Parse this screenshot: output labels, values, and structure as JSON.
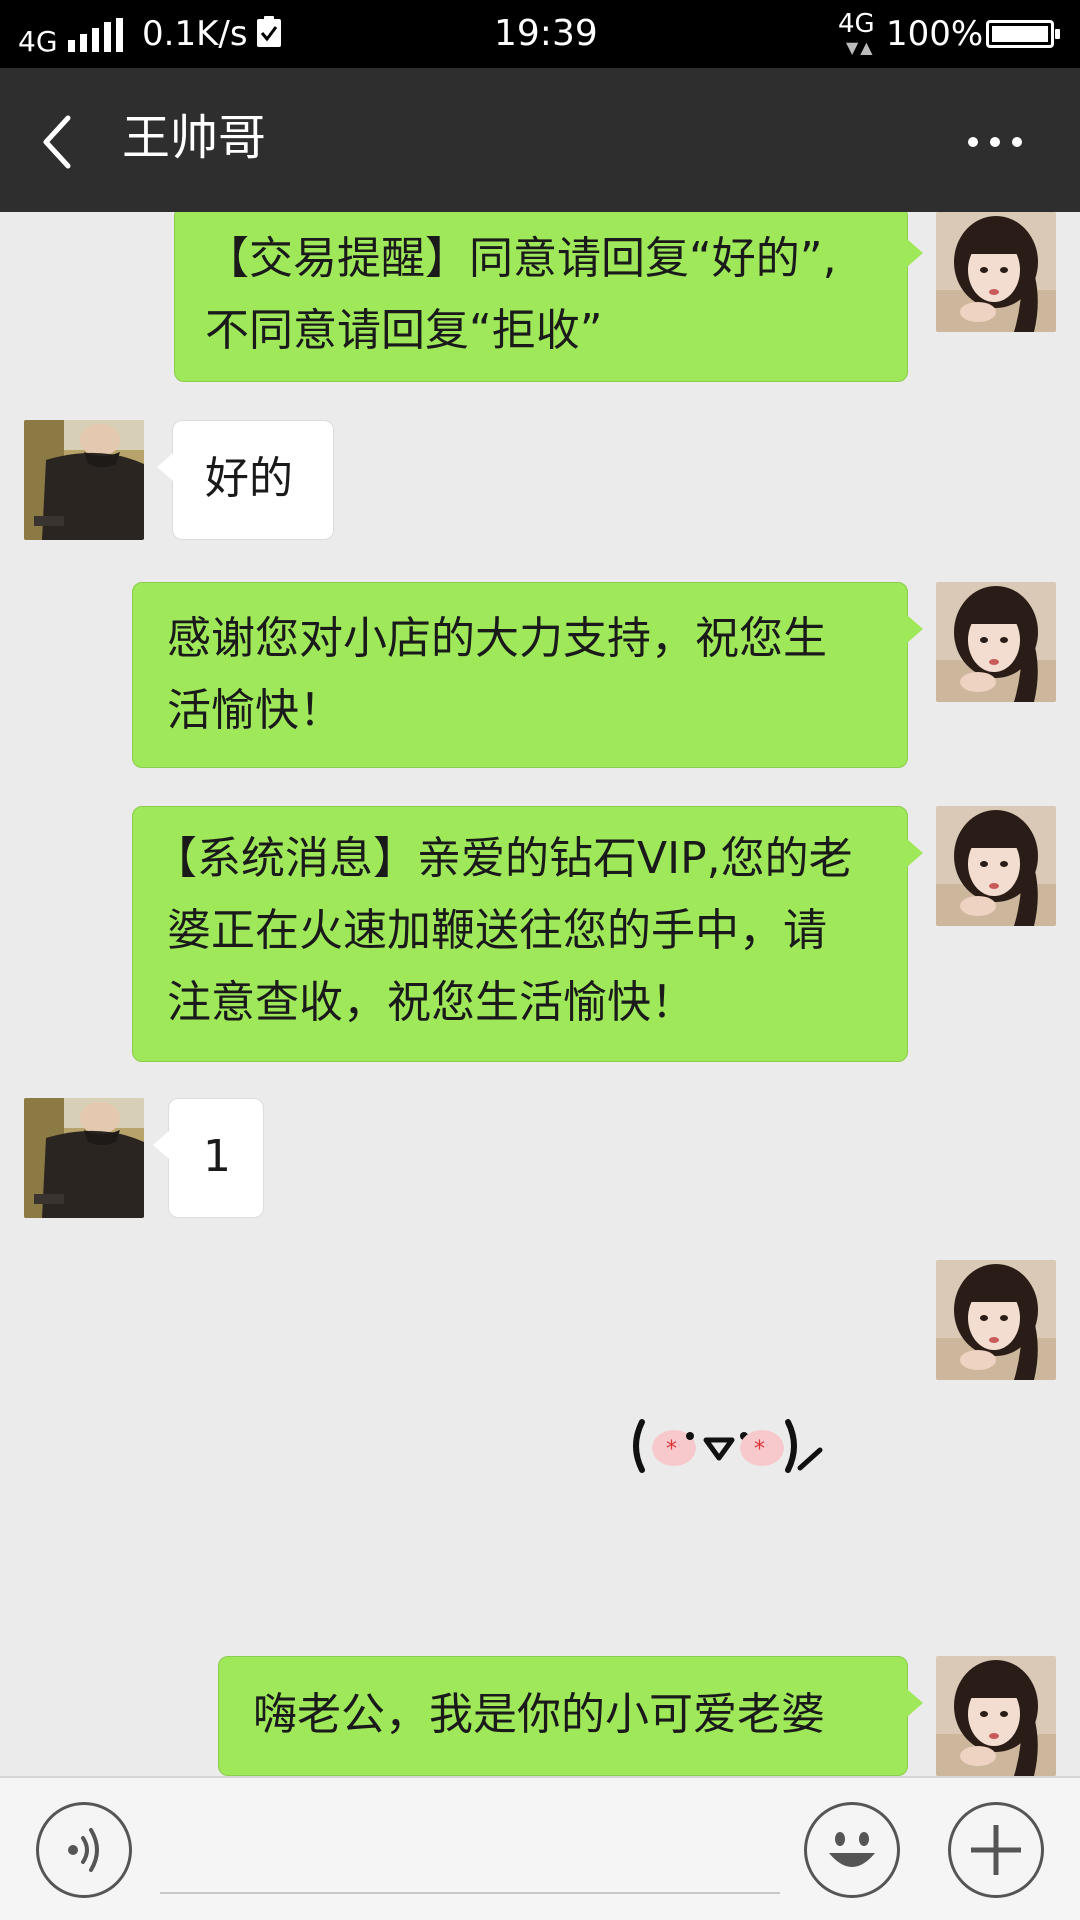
{
  "status_bar": {
    "network_left": "4G",
    "speed": "0.1K/s",
    "time": "19:39",
    "network_right": "4G",
    "battery": "100%",
    "icons": [
      "signal-icon",
      "check-icon",
      "battery-icon"
    ]
  },
  "header": {
    "title": "王帅哥",
    "back_icon": "back-chevron-icon",
    "more_icon": "more-dots-icon"
  },
  "messages": [
    {
      "side": "right",
      "lines": [
        "【交易提醒】同意请回复“好的”,",
        "不同意请回复“拒收”"
      ]
    },
    {
      "side": "left",
      "lines": [
        "好的"
      ]
    },
    {
      "side": "right",
      "lines": [
        "感谢您对小店的大力支持，祝您生",
        "活愉快！"
      ]
    },
    {
      "side": "right",
      "lines": [
        "【系统消息】亲爱的钻石VIP,您的老",
        "婆正在火速加鞭送往您的手中，请",
        "注意查收，祝您生活愉快！"
      ]
    },
    {
      "side": "left",
      "lines": [
        "1"
      ]
    },
    {
      "side": "right",
      "type": "sticker",
      "sticker": "kaomoji-sticker"
    },
    {
      "side": "right",
      "lines": [
        "嗨老公，我是你的小可爱老婆"
      ]
    }
  ],
  "input_bar": {
    "voice_icon": "voice-icon",
    "emoji_icon": "emoji-icon",
    "plus_icon": "plus-icon"
  },
  "colors": {
    "sent_bubble": "#9fe85a",
    "received_bubble": "#ffffff",
    "header_bg": "#2e2e2e",
    "chat_bg": "#ebebeb"
  }
}
